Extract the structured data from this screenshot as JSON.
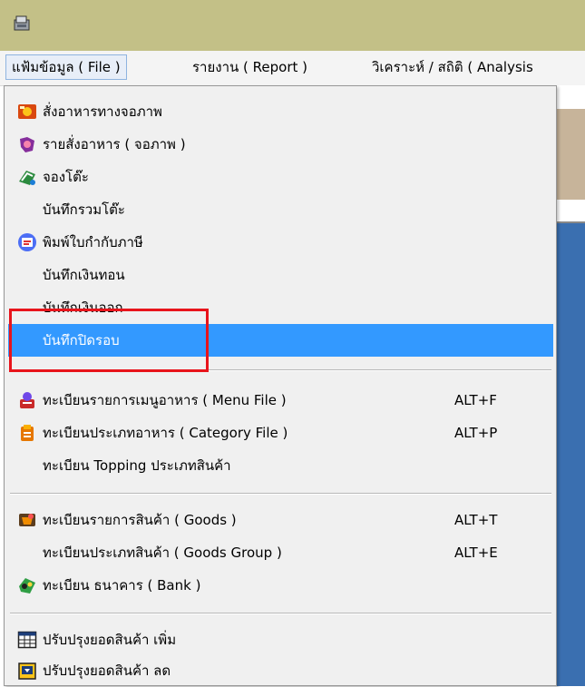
{
  "menubar": {
    "items": [
      {
        "label": "แฟ้มข้อมูล ( File )"
      },
      {
        "label": "รายงาน ( Report )"
      },
      {
        "label": "วิเคราะห์ / สถิติ ( Analysis"
      }
    ]
  },
  "file_menu": {
    "items": [
      {
        "label": "สั่งอาหารทางจอภาพ",
        "shortcut": ""
      },
      {
        "label": "รายสั่งอาหาร ( จอภาพ )",
        "shortcut": ""
      },
      {
        "label": "จองโต๊ะ",
        "shortcut": ""
      },
      {
        "label": "บันทึกรวมโต๊ะ",
        "shortcut": ""
      },
      {
        "label": "พิมพ์ใบกำกับภาษี",
        "shortcut": ""
      },
      {
        "label": "บันทึกเงินทอน",
        "shortcut": ""
      },
      {
        "label": "บันทึกเงินออก",
        "shortcut": ""
      },
      {
        "label": "บันทึกปิดรอบ",
        "shortcut": ""
      },
      {
        "label": "ทะเบียนรายการเมนูอาหาร ( Menu File )",
        "shortcut": "ALT+F"
      },
      {
        "label": "ทะเบียนประเภทอาหาร ( Category File )",
        "shortcut": "ALT+P"
      },
      {
        "label": "ทะเบียน Topping ประเภทสินค้า",
        "shortcut": ""
      },
      {
        "label": "ทะเบียนรายการสินค้า ( Goods )",
        "shortcut": "ALT+T"
      },
      {
        "label": "ทะเบียนประเภทสินค้า ( Goods Group )",
        "shortcut": "ALT+E"
      },
      {
        "label": "ทะเบียน ธนาคาร ( Bank )",
        "shortcut": ""
      },
      {
        "label": "ปรับปรุงยอดสินค้า เพิ่ม",
        "shortcut": ""
      },
      {
        "label": "ปรับปรุงยอดสินค้า ลด",
        "shortcut": ""
      }
    ]
  },
  "colors": {
    "titlebar": "#c3c087",
    "selection": "#3399ff",
    "highlight_box": "#e8141b"
  }
}
